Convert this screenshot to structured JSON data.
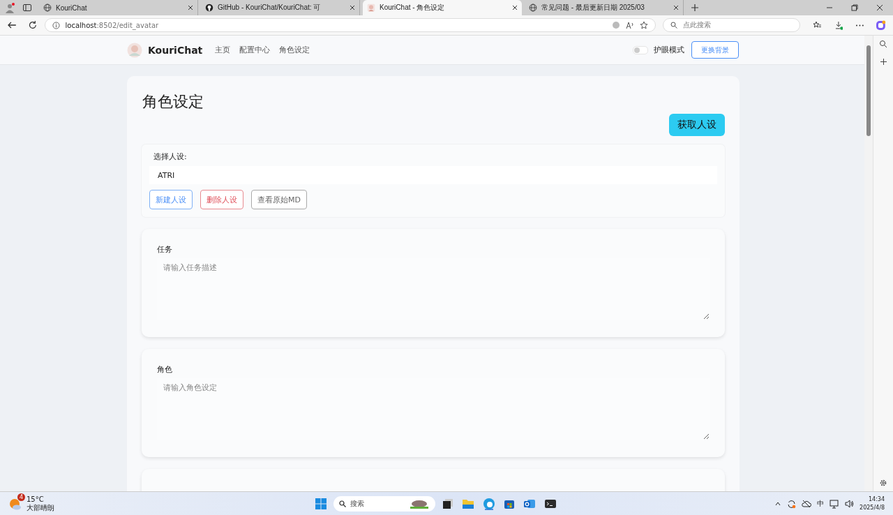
{
  "browser": {
    "tabs": [
      {
        "title": "KouriChat",
        "kind": "globe",
        "selected": false
      },
      {
        "title": "GitHub - KouriChat/KouriChat: 可",
        "kind": "github",
        "selected": false
      },
      {
        "title": "KouriChat - 角色设定",
        "kind": "avatar",
        "selected": true
      },
      {
        "title": "常见问题 - 最后更新日期 2025/03",
        "kind": "globe",
        "selected": false
      }
    ],
    "url_host": "localhost",
    "url_rest": ":8502/edit_avatar",
    "search_placeholder": "点此搜索"
  },
  "navbar": {
    "brand": "KouriChat",
    "links": [
      "主页",
      "配置中心",
      "角色设定"
    ],
    "eye_mode": {
      "label": "护眼模式",
      "on": false
    },
    "background_button": "更换背景"
  },
  "page": {
    "title": "角色设定",
    "fetch_button": "获取人设",
    "persona": {
      "label": "选择人设:",
      "value": "ATRI",
      "buttons": [
        {
          "label": "新建人设",
          "kind": "primary"
        },
        {
          "label": "删除人设",
          "kind": "danger"
        },
        {
          "label": "查看原始MD",
          "kind": "secondary"
        }
      ]
    },
    "sections": [
      {
        "label": "任务",
        "placeholder": "请输入任务描述"
      },
      {
        "label": "角色",
        "placeholder": "请输入角色设定"
      }
    ]
  },
  "taskbar": {
    "weather": {
      "temp": "15°C",
      "desc": "大部晴朗",
      "badge": "4"
    },
    "search_placeholder": "搜索",
    "ime": "中",
    "time": "14:34",
    "date": "2025/4/8"
  }
}
